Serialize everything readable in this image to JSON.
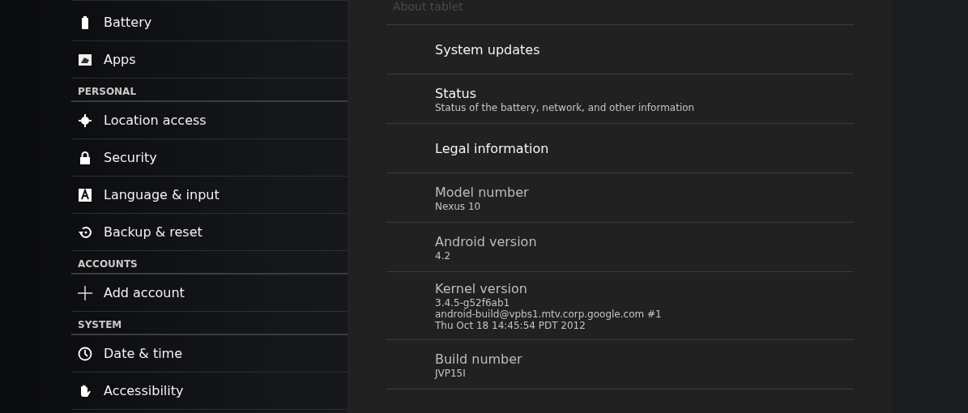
{
  "sidebar": {
    "sections": [
      {
        "items": [
          {
            "label": "Battery"
          },
          {
            "label": "Apps"
          }
        ]
      },
      {
        "header": "PERSONAL",
        "items": [
          {
            "label": "Location access"
          },
          {
            "label": "Security"
          },
          {
            "label": "Language & input"
          },
          {
            "label": "Backup & reset"
          }
        ]
      },
      {
        "header": "ACCOUNTS",
        "items": [
          {
            "label": "Add account"
          }
        ]
      },
      {
        "header": "SYSTEM",
        "items": [
          {
            "label": "Date & time"
          },
          {
            "label": "Accessibility"
          }
        ]
      }
    ]
  },
  "detail": {
    "title": "About tablet",
    "items": [
      {
        "kind": "link",
        "title": "System updates"
      },
      {
        "kind": "link",
        "title": "Status",
        "summary": [
          "Status of the battery, network, and other information"
        ]
      },
      {
        "kind": "link",
        "title": "Legal information"
      },
      {
        "kind": "info",
        "title": "Model number",
        "summary": [
          "Nexus 10"
        ]
      },
      {
        "kind": "info",
        "title": "Android version",
        "summary": [
          "4.2"
        ]
      },
      {
        "kind": "info",
        "title": "Kernel version",
        "summary": [
          "3.4.5-g52f6ab1",
          "android-build@vpbs1.mtv.corp.google.com #1",
          "Thu Oct 18 14:45:54 PDT 2012"
        ]
      },
      {
        "kind": "info",
        "title": "Build number",
        "summary": [
          "JVP15I"
        ]
      }
    ]
  }
}
